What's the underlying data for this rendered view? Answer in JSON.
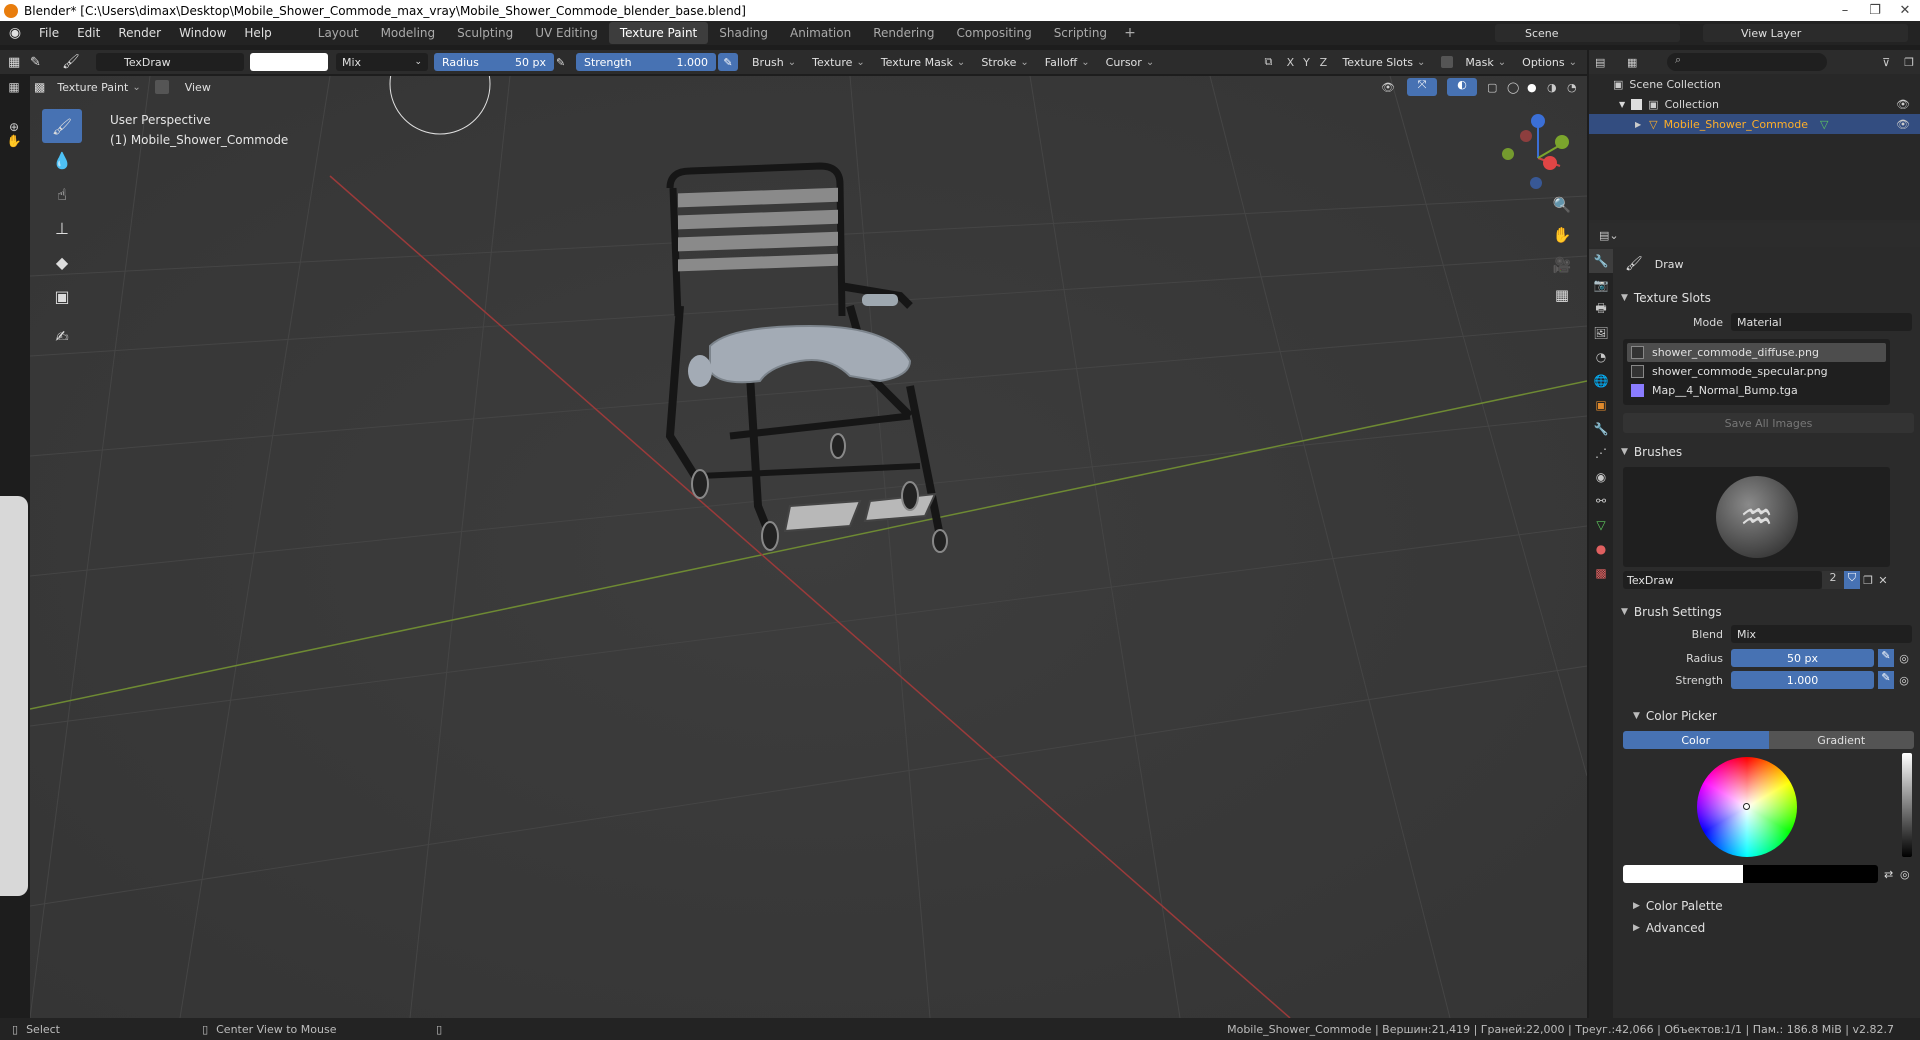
{
  "titlebar": {
    "text": "Blender* [C:\\Users\\dimax\\Desktop\\Mobile_Shower_Commode_max_vray\\Mobile_Shower_Commode_blender_base.blend]"
  },
  "menu": [
    "File",
    "Edit",
    "Render",
    "Window",
    "Help"
  ],
  "workspaces": [
    "Layout",
    "Modeling",
    "Sculpting",
    "UV Editing",
    "Texture Paint",
    "Shading",
    "Animation",
    "Rendering",
    "Compositing",
    "Scripting"
  ],
  "active_workspace": "Texture Paint",
  "scene": "Scene",
  "view_layer": "View Layer",
  "toolbar": {
    "brush_name": "TexDraw",
    "blend": "Mix",
    "radius_label": "Radius",
    "radius_value": "50 px",
    "strength_label": "Strength",
    "strength_value": "1.000",
    "dropdowns": [
      "Brush",
      "Texture",
      "Texture Mask",
      "Stroke",
      "Falloff",
      "Cursor"
    ],
    "axes": [
      "X",
      "Y",
      "Z"
    ],
    "texture_slots": "Texture Slots",
    "mask": "Mask",
    "options": "Options"
  },
  "header2": {
    "mode": "Texture Paint",
    "view": "View"
  },
  "viewport": {
    "perspective": "User Perspective",
    "object": "(1) Mobile_Shower_Commode"
  },
  "outliner": {
    "scene_collection": "Scene Collection",
    "collection": "Collection",
    "object": "Mobile_Shower_Commode"
  },
  "properties": {
    "tool_name": "Draw",
    "texture_slots": {
      "title": "Texture Slots",
      "mode_label": "Mode",
      "mode_value": "Material",
      "slots": [
        "shower_commode_diffuse.png",
        "shower_commode_specular.png",
        "Map__4_Normal_Bump.tga"
      ],
      "save_all": "Save All Images"
    },
    "brushes": {
      "title": "Brushes",
      "brush_name": "TexDraw",
      "users": "2"
    },
    "brush_settings": {
      "title": "Brush Settings",
      "blend_label": "Blend",
      "blend_value": "Mix",
      "radius_label": "Radius",
      "radius_value": "50 px",
      "strength_label": "Strength",
      "strength_value": "1.000"
    },
    "color_picker": {
      "title": "Color Picker",
      "tab_color": "Color",
      "tab_gradient": "Gradient"
    },
    "color_palette": "Color Palette",
    "advanced": "Advanced"
  },
  "status": {
    "select": "Select",
    "center_view": "Center View to Mouse",
    "stats": "Mobile_Shower_Commode | Вершин:21,419 | Граней:22,000 | Треуг.:42,066 | Объектов:1/1 | Пам.: 186.8 MiB | v2.82.7"
  },
  "colors": {
    "accent": "#4772b3",
    "selected_object": "#ffaf29",
    "viewport_bg": "#3a3a3a"
  }
}
